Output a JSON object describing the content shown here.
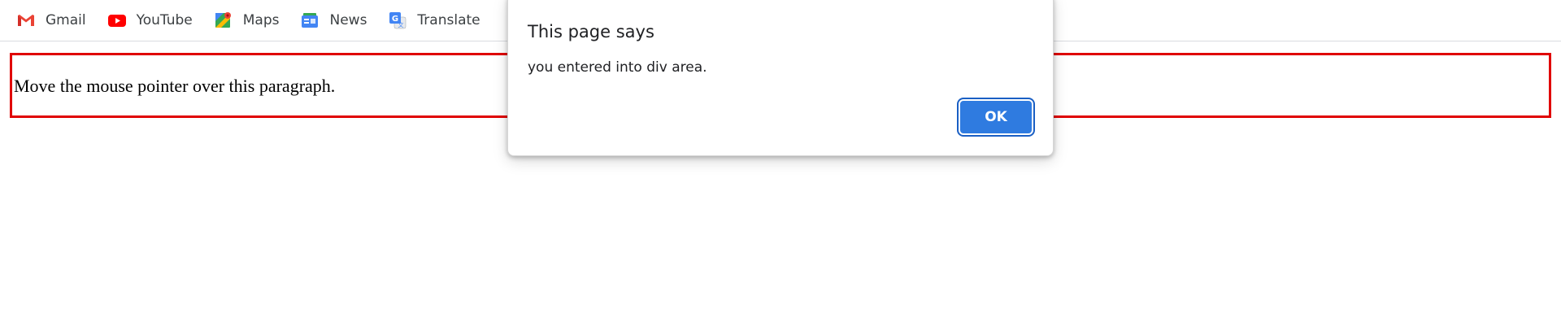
{
  "bookmarks": [
    {
      "label": "Gmail",
      "icon": "gmail-icon"
    },
    {
      "label": "YouTube",
      "icon": "youtube-icon"
    },
    {
      "label": "Maps",
      "icon": "maps-icon"
    },
    {
      "label": "News",
      "icon": "news-icon"
    },
    {
      "label": "Translate",
      "icon": "translate-icon"
    }
  ],
  "page": {
    "paragraph": "Move the mouse pointer over this paragraph.",
    "border_color": "#e00000"
  },
  "dialog": {
    "title": "This page says",
    "message": "you entered into div area.",
    "ok_label": "OK",
    "button_color": "#2f7be0"
  }
}
